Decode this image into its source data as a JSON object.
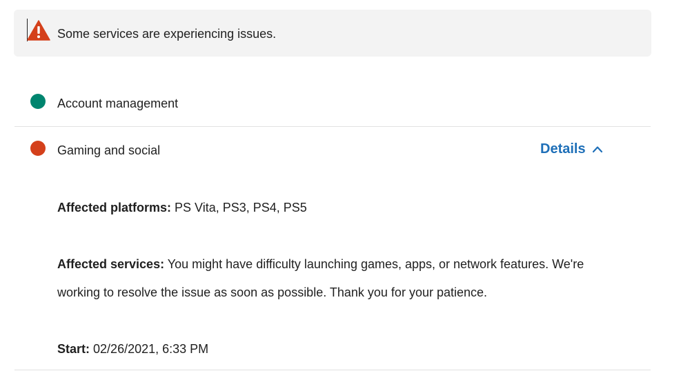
{
  "banner": {
    "message": "Some services are experiencing issues.",
    "icon": "warning-triangle-icon",
    "icon_color": "#d4401b"
  },
  "services": [
    {
      "name": "Account management",
      "status_color": "#00856f"
    },
    {
      "name": "Gaming and social",
      "status_color": "#d4401b",
      "details_label": "Details",
      "details_expanded": true,
      "details": {
        "platforms_label": "Affected platforms:",
        "platforms_value": "PS Vita, PS3, PS4, PS5",
        "services_label": "Affected services:",
        "services_value_line1": "You might have difficulty launching games, apps, or network features. We're",
        "services_value_line2": "working to resolve the issue as soon as possible. Thank you for your patience.",
        "start_label": "Start:",
        "start_value": "02/26/2021, 6:33 PM"
      }
    }
  ],
  "colors": {
    "link": "#1e6fb8",
    "banner_bg": "#f3f3f3",
    "divider": "#e1e1e1"
  }
}
